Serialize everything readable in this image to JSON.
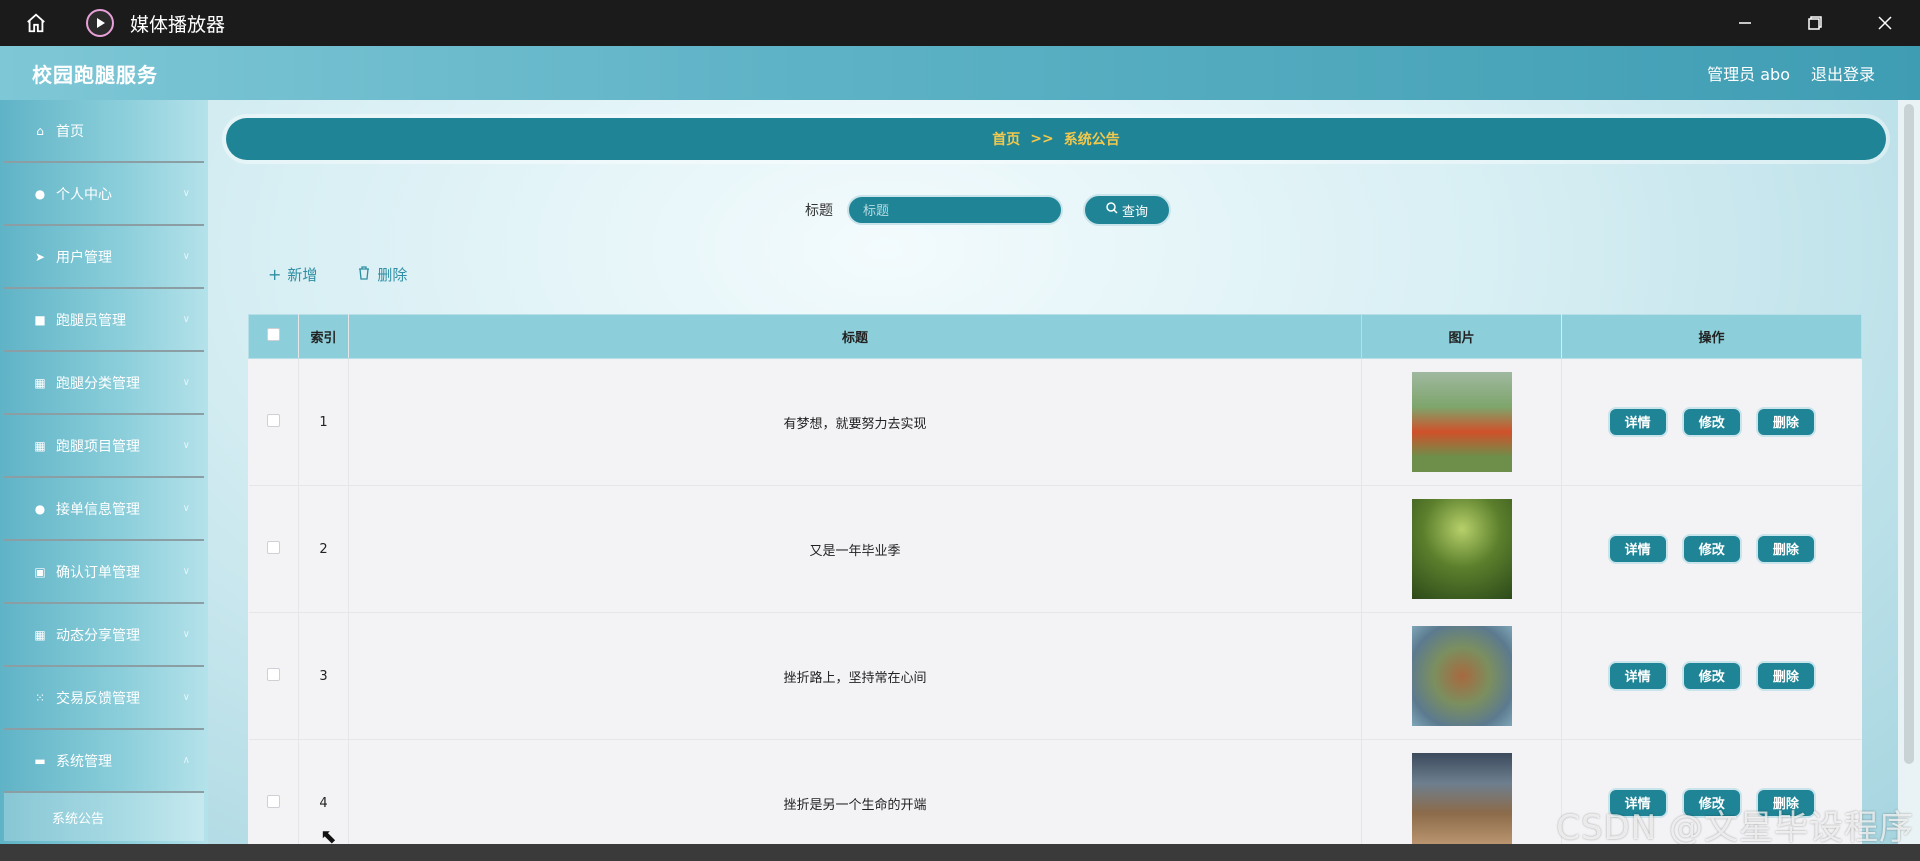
{
  "window": {
    "title": "媒体播放器",
    "home_icon": "home-icon",
    "app_icon": "play-icon",
    "controls": [
      "minimize-icon",
      "restore-icon",
      "close-icon"
    ]
  },
  "header": {
    "brand": "校园跑腿服务",
    "user_label": "管理员 abo",
    "logout_label": "退出登录"
  },
  "sidebar": {
    "items": [
      {
        "label": "首页",
        "icon": "home-icon"
      },
      {
        "label": "个人中心",
        "icon": "user-icon"
      },
      {
        "label": "用户管理",
        "icon": "send-icon"
      },
      {
        "label": "跑腿员管理",
        "icon": "briefcase-icon"
      },
      {
        "label": "跑腿分类管理",
        "icon": "grid-icon"
      },
      {
        "label": "跑腿项目管理",
        "icon": "grid-icon"
      },
      {
        "label": "接单信息管理",
        "icon": "user-icon"
      },
      {
        "label": "确认订单管理",
        "icon": "printer-icon"
      },
      {
        "label": "动态分享管理",
        "icon": "grid-icon"
      },
      {
        "label": "交易反馈管理",
        "icon": "apps-icon"
      },
      {
        "label": "系统管理",
        "icon": "id-card-icon"
      }
    ],
    "sub_item": "系统公告"
  },
  "breadcrumb": {
    "home": "首页",
    "separator": ">>",
    "current": "系统公告"
  },
  "search": {
    "label": "标题",
    "placeholder": "标题",
    "button": "查询"
  },
  "actions": {
    "add": "新增",
    "delete": "删除"
  },
  "table": {
    "headers": {
      "index": "索引",
      "title": "标题",
      "image": "图片",
      "ops": "操作"
    },
    "rows": [
      {
        "index": "1",
        "title": "有梦想，就要努力去实现"
      },
      {
        "index": "2",
        "title": "又是一年毕业季"
      },
      {
        "index": "3",
        "title": "挫折路上，坚持常在心间"
      },
      {
        "index": "4",
        "title": "挫折是另一个生命的开端"
      }
    ],
    "op_labels": {
      "detail": "详情",
      "edit": "修改",
      "delete": "删除"
    }
  },
  "watermark": "CSDN @文星毕设程序",
  "colors": {
    "accent": "#1f8496",
    "breadcrumb_text": "#f2c94c",
    "table_header": "#8ccfdb"
  }
}
